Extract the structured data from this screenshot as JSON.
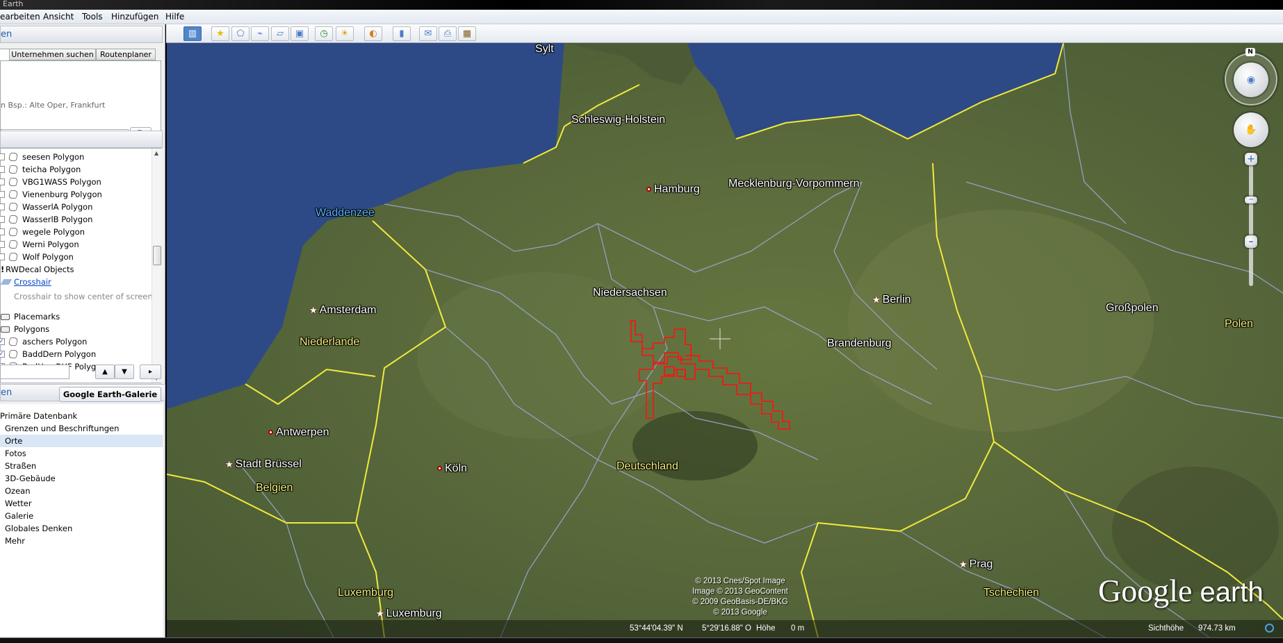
{
  "window": {
    "title": "Earth"
  },
  "menu": [
    "earbeiten",
    "Ansicht",
    "Tools",
    "Hinzufügen",
    "Hilfe"
  ],
  "search": {
    "header": "en",
    "tabs": [
      "Unternehmen suchen",
      "Routenplaner"
    ],
    "hint": "n Bsp.: Alte Oper, Frankfurt",
    "value": ""
  },
  "places": {
    "items": [
      {
        "label": "seesen Polygon",
        "type": "polygon",
        "checked": false,
        "indent": 1
      },
      {
        "label": "teicha Polygon",
        "type": "polygon",
        "checked": false,
        "indent": 1
      },
      {
        "label": "VBG1WASS Polygon",
        "type": "polygon",
        "checked": false,
        "indent": 1
      },
      {
        "label": "Vienenburg Polygon",
        "type": "polygon",
        "checked": false,
        "indent": 1
      },
      {
        "label": "WasserlA Polygon",
        "type": "polygon",
        "checked": false,
        "indent": 1
      },
      {
        "label": "WasserlB Polygon",
        "type": "polygon",
        "checked": false,
        "indent": 1
      },
      {
        "label": "wegele Polygon",
        "type": "polygon",
        "checked": false,
        "indent": 1
      },
      {
        "label": "Werni Polygon",
        "type": "polygon",
        "checked": false,
        "indent": 1
      },
      {
        "label": "Wolf Polygon",
        "type": "polygon",
        "checked": false,
        "indent": 1
      },
      {
        "label": "RWDecal Objects",
        "type": "folder-text",
        "checked": false,
        "indent": 0
      },
      {
        "label": "Crosshair",
        "type": "link",
        "checked": false,
        "indent": 0
      },
      {
        "label": "Crosshair to show center of screen",
        "type": "desc",
        "checked": false,
        "indent": 0
      },
      {
        "label": "Placemarks",
        "type": "folder",
        "checked": false,
        "indent": 0
      },
      {
        "label": "Polygons",
        "type": "folder-open",
        "checked": false,
        "indent": 0
      },
      {
        "label": "aschers Polygon",
        "type": "polygon",
        "checked": true,
        "indent": 1
      },
      {
        "label": "BaddDern Polygon",
        "type": "polygon",
        "checked": true,
        "indent": 1
      },
      {
        "label": "BadHar_RHF Polygon",
        "type": "polygon",
        "checked": true,
        "indent": 1
      }
    ]
  },
  "layers": {
    "header": "en",
    "gallery_button": "Google Earth-Galerie »",
    "items": [
      "Primäre Datenbank",
      "Grenzen und Beschriftungen",
      "Orte",
      "Fotos",
      "Straßen",
      "3D-Gebäude",
      "Ozean",
      "Wetter",
      "Galerie",
      "Globales Denken",
      "Mehr"
    ],
    "selected": "Orte"
  },
  "toolbar": [
    "sidebar-toggle",
    "add-placemark",
    "add-polygon",
    "add-path",
    "add-image-overlay",
    "record-tour",
    "historical-imagery",
    "sunlight",
    "switch-planet",
    "ruler",
    "email",
    "print",
    "save-image"
  ],
  "map": {
    "labels": [
      {
        "text": "Schleswig-Holstein",
        "style": "w"
      },
      {
        "text": "Hamburg",
        "style": "city"
      },
      {
        "text": "Mecklenburg-Vorpommern",
        "style": "w"
      },
      {
        "text": "Waddenzee",
        "style": "b"
      },
      {
        "text": "Niedersachsen",
        "style": "w"
      },
      {
        "text": "Berlin",
        "style": "capital"
      },
      {
        "text": "Amsterdam",
        "style": "capital"
      },
      {
        "text": "Niederlande",
        "style": "y"
      },
      {
        "text": "Brandenburg",
        "style": "w"
      },
      {
        "text": "Großpolen",
        "style": "w"
      },
      {
        "text": "Polen",
        "style": "y"
      },
      {
        "text": "Antwerpen",
        "style": "city"
      },
      {
        "text": "Stadt Brüssel",
        "style": "capital"
      },
      {
        "text": "Belgien",
        "style": "y"
      },
      {
        "text": "Köln",
        "style": "city"
      },
      {
        "text": "Deutschland",
        "style": "y"
      },
      {
        "text": "Prag",
        "style": "capital"
      },
      {
        "text": "Tschechien",
        "style": "y"
      },
      {
        "text": "Luxemburg",
        "style": "y"
      },
      {
        "text": "Luxemburg",
        "style": "capital"
      },
      {
        "text": "Sylt",
        "style": "w"
      }
    ],
    "copyright": [
      "© 2013 Cnes/Spot Image",
      "Image © 2013 GeoContent",
      "© 2009 GeoBasis-DE/BKG",
      "© 2013 Google"
    ],
    "logo": {
      "a": "Google",
      "b": " earth"
    },
    "status": {
      "lat": "53°44'04.39\" N",
      "lon": "5°29'16.88\" O",
      "elev_label": "Höhe",
      "elev": "0 m",
      "eye_label": "Sichthöhe",
      "eye": "974.73 km"
    },
    "compass": "N",
    "colors": {
      "sea": "#2d4a86",
      "land": "#5b6a3c",
      "border_country": "#f0ea3c",
      "border_state": "#9aa6d0",
      "polygon": "#ff1010"
    }
  }
}
